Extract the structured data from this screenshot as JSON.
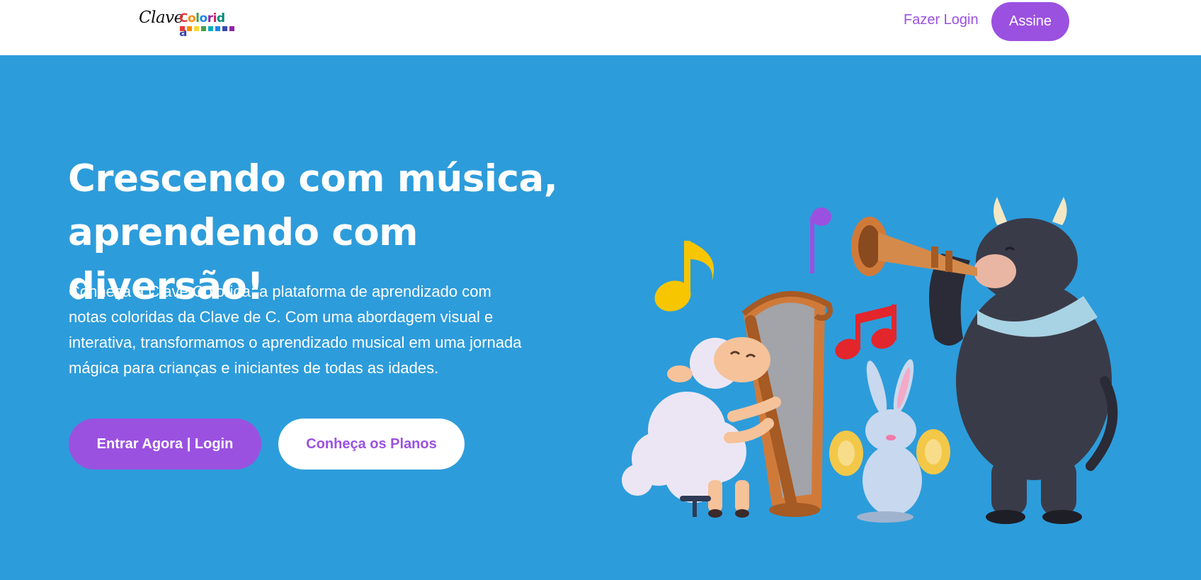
{
  "header": {
    "logo": {
      "word1": "Clave",
      "word2": "Colorida",
      "letter_colors": [
        "#e53935",
        "#fb8c00",
        "#43a047",
        "#1e88e5",
        "#8e24aa",
        "#d81b60",
        "#00897b",
        "#3949ab"
      ],
      "square_colors": [
        "#e53935",
        "#fb8c00",
        "#fdd835",
        "#43a047",
        "#00acc1",
        "#1e88e5",
        "#3949ab",
        "#8e24aa"
      ]
    },
    "login_label": "Fazer Login",
    "subscribe_label": "Assine"
  },
  "hero": {
    "title_line1": "Crescendo com música,",
    "title_line2": "aprendendo com diversão!",
    "description": "Conheça a Clave Colorida: a plataforma de aprendizado com notas coloridas da Clave de C. Com uma abordagem visual e interativa, transformamos o aprendizado musical em uma jornada mágica para crianças e iniciantes de todas as idades.",
    "primary_button": "Entrar Agora | Login",
    "secondary_button": "Conheça os Planos",
    "illustration": {
      "animals": [
        "sheep-harp",
        "rabbit-cymbals",
        "bull-trumpet"
      ],
      "note_colors": [
        "#f7c600",
        "#9b51e0",
        "#e3252c"
      ]
    }
  },
  "colors": {
    "accent": "#9b51e0",
    "hero_background": "#2d9cdb",
    "header_background": "#ffffff"
  }
}
